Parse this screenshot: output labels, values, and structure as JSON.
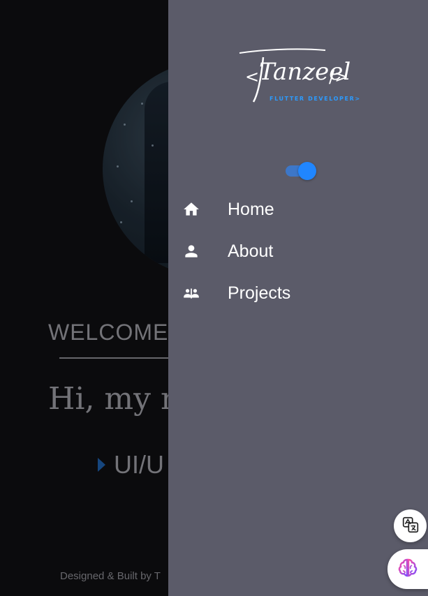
{
  "background": {
    "welcome_text": "WELCOME",
    "greeting_text": "Hi, my na",
    "role_text": "UI/U",
    "footer_text": "Designed & Built by T"
  },
  "drawer": {
    "logo": {
      "name": "Tanzeel",
      "tagline": "FLUTTER DEVELOPER>",
      "left_bracket": "<",
      "right_bracket": "/>"
    },
    "theme_toggle": {
      "state": "on"
    },
    "menu": [
      {
        "label": "Home",
        "icon": "home-icon"
      },
      {
        "label": "About",
        "icon": "person-icon"
      },
      {
        "label": "Projects",
        "icon": "group-icon"
      }
    ]
  },
  "floating_buttons": [
    {
      "icon": "translate-icon"
    },
    {
      "icon": "brain-icon"
    }
  ],
  "colors": {
    "drawer_bg": "#5b5b69",
    "accent": "#2086ff",
    "page_bg": "#0f0f12"
  }
}
